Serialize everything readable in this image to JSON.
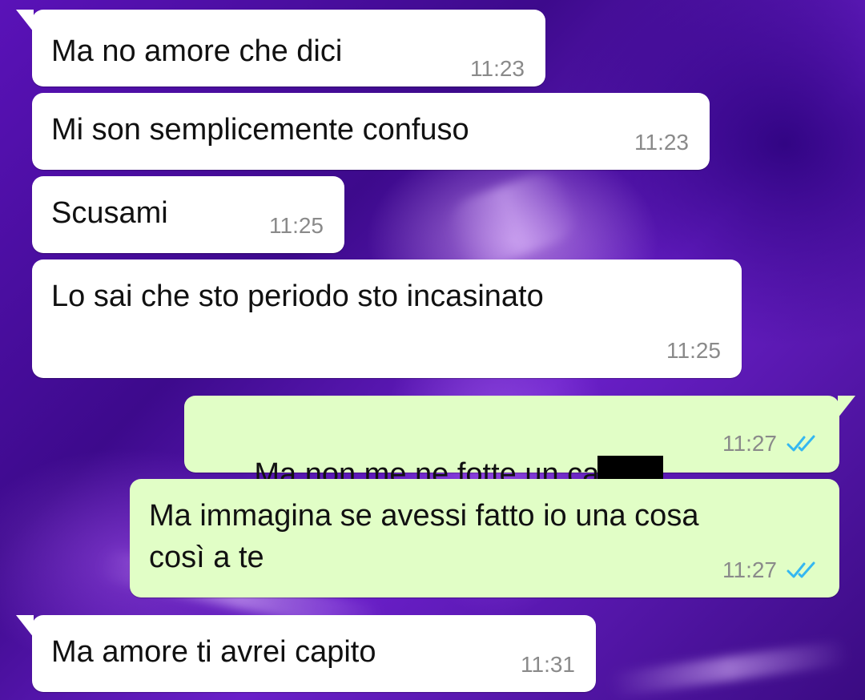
{
  "colors": {
    "incoming_bubble": "#ffffff",
    "outgoing_bubble": "#e1fec6",
    "timestamp": "#8a8a8a",
    "read_ticks": "#34b7f1",
    "wallpaper": "#4b0fa0"
  },
  "messages": [
    {
      "direction": "incoming",
      "text": "Ma no amore che dici",
      "time": "11:23"
    },
    {
      "direction": "incoming",
      "text": "Mi son semplicemente confuso",
      "time": "11:23"
    },
    {
      "direction": "incoming",
      "text": "Scusami",
      "time": "11:25"
    },
    {
      "direction": "incoming",
      "text": "Lo sai che sto periodo sto incasinato",
      "time": "11:25"
    },
    {
      "direction": "outgoing",
      "text": "Ma non me ne fotte un ca",
      "redacted": true,
      "time": "11:27",
      "status_icon": "double-check-read-icon"
    },
    {
      "direction": "outgoing",
      "text": "Ma immagina se avessi fatto io una cosa\ncosì a te",
      "time": "11:27",
      "status_icon": "double-check-read-icon"
    },
    {
      "direction": "incoming",
      "text": "Ma amore ti avrei capito",
      "time": "11:31"
    }
  ]
}
